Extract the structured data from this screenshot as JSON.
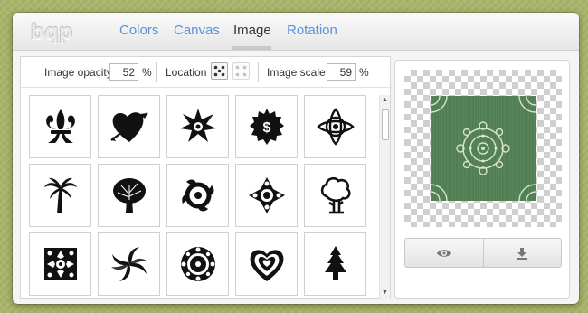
{
  "app": {
    "logo_text": "bqp"
  },
  "tabs": [
    {
      "label": "Colors",
      "active": false
    },
    {
      "label": "Canvas",
      "active": false
    },
    {
      "label": "Image",
      "active": true
    },
    {
      "label": "Rotation",
      "active": false
    }
  ],
  "controls": {
    "image_opacity_label": "Image opacity",
    "image_opacity_value": "52",
    "image_opacity_unit": "%",
    "location_label": "Location",
    "image_scale_label": "Image scale",
    "image_scale_value": "59",
    "image_scale_unit": "%"
  },
  "images": [
    {
      "icon": "fleur-de-lis-icon"
    },
    {
      "icon": "heart-arrow-icon"
    },
    {
      "icon": "star-burst-icon"
    },
    {
      "icon": "dollar-badge-icon"
    },
    {
      "icon": "celtic-knot-icon"
    },
    {
      "icon": "palm-tree-icon"
    },
    {
      "icon": "oak-tree-icon"
    },
    {
      "icon": "tribal-swirl-icon"
    },
    {
      "icon": "flower-ornament-icon"
    },
    {
      "icon": "cartoon-tree-icon"
    },
    {
      "icon": "damask-square-icon"
    },
    {
      "icon": "swirl-vortex-icon"
    },
    {
      "icon": "mandala-icon"
    },
    {
      "icon": "nested-heart-icon"
    },
    {
      "icon": "pine-tree-icon"
    }
  ],
  "colors": {
    "tab_link": "#5b93d8",
    "tab_active": "#333333",
    "preview_tile": "#517f53"
  }
}
